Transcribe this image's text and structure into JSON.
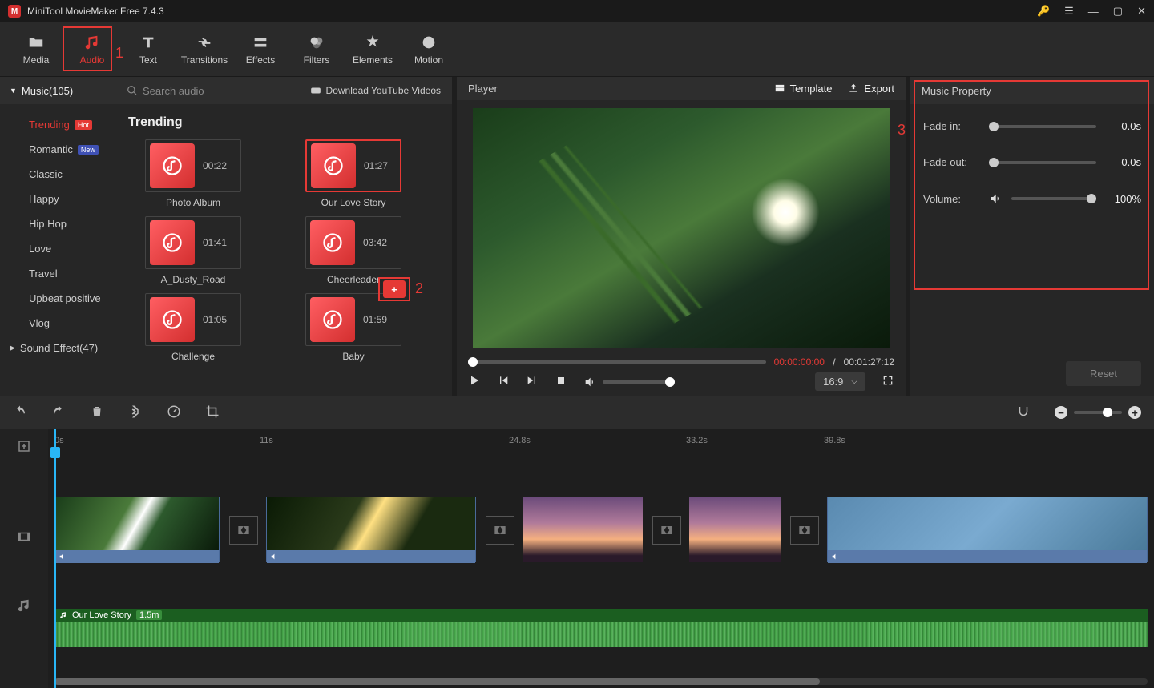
{
  "titlebar": {
    "title": "MiniTool MovieMaker Free 7.4.3"
  },
  "tabs": {
    "media": "Media",
    "audio": "Audio",
    "text": "Text",
    "transitions": "Transitions",
    "effects": "Effects",
    "filters": "Filters",
    "elements": "Elements",
    "motion": "Motion"
  },
  "annotations": {
    "a1": "1",
    "a2": "2",
    "a3": "3"
  },
  "library": {
    "category": "Music(105)",
    "search_placeholder": "Search audio",
    "youtube": "Download YouTube Videos",
    "section_title": "Trending",
    "cats": {
      "trending": "Trending",
      "romantic": "Romantic",
      "classic": "Classic",
      "happy": "Happy",
      "hiphop": "Hip Hop",
      "love": "Love",
      "travel": "Travel",
      "upbeat": "Upbeat positive",
      "vlog": "Vlog"
    },
    "badges": {
      "hot": "Hot",
      "new": "New"
    },
    "sound_effect": "Sound Effect(47)",
    "items": [
      {
        "duration": "00:22",
        "name": "Photo Album"
      },
      {
        "duration": "01:27",
        "name": "Our Love Story"
      },
      {
        "duration": "01:41",
        "name": "A_Dusty_Road"
      },
      {
        "duration": "03:42",
        "name": "Cheerleader"
      },
      {
        "duration": "01:05",
        "name": "Challenge"
      },
      {
        "duration": "01:59",
        "name": "Baby"
      }
    ]
  },
  "player": {
    "title": "Player",
    "template": "Template",
    "export": "Export",
    "tc_current": "00:00:00:00",
    "tc_sep": " / ",
    "tc_total": "00:01:27:12",
    "aspect": "16:9"
  },
  "props": {
    "title": "Music Property",
    "fade_in": "Fade in:",
    "fade_in_val": "0.0s",
    "fade_out": "Fade out:",
    "fade_out_val": "0.0s",
    "volume": "Volume:",
    "volume_val": "100%",
    "reset": "Reset"
  },
  "ruler": {
    "t0": "0s",
    "t1": "11s",
    "t2": "24.8s",
    "t3": "33.2s",
    "t4": "39.8s"
  },
  "audio_clip": {
    "name": "Our Love Story",
    "dur": "1.5m"
  }
}
